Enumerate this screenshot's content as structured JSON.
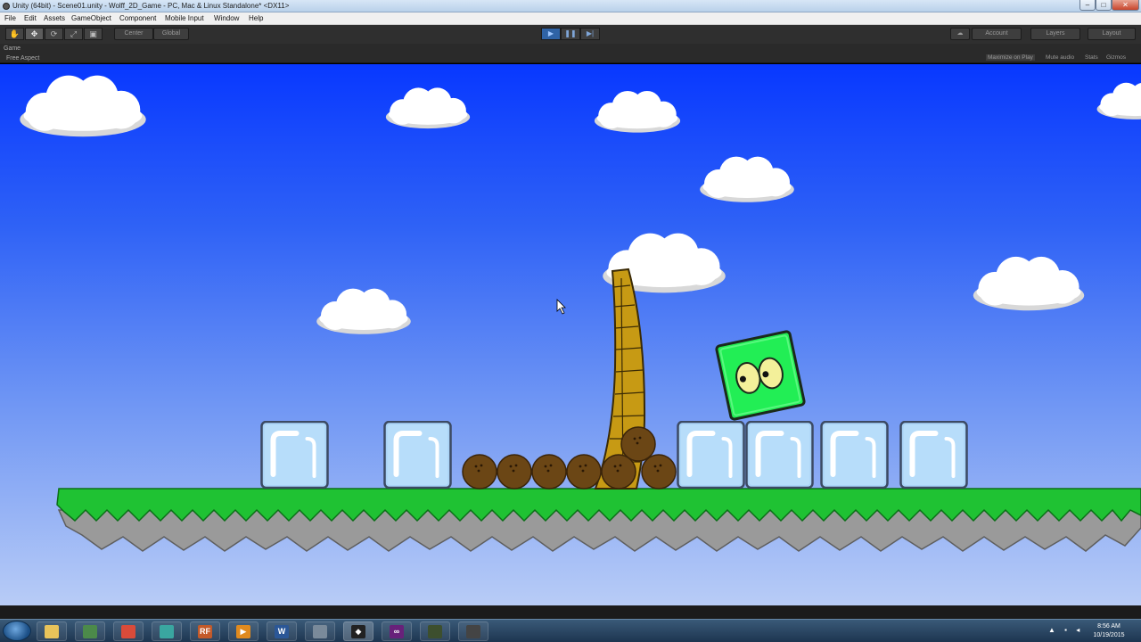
{
  "window": {
    "title": "Unity (64bit) - Scene01.unity - Wolff_2D_Game - PC, Mac & Linux Standalone* <DX11>",
    "min": "–",
    "max": "□",
    "close": "✕"
  },
  "menu": [
    "File",
    "Edit",
    "Assets",
    "GameObject",
    "Component",
    "Mobile Input",
    "Window",
    "Help"
  ],
  "toolbar": {
    "tools": [
      "✋",
      "✥",
      "⟳",
      "⤢",
      "▣"
    ],
    "pivot": "Center",
    "space": "Global",
    "play": "▶",
    "pause": "❚❚",
    "step": "▶|",
    "cloud": "☁",
    "account": "Account",
    "layers": "Layers",
    "layout": "Layout"
  },
  "game_view": {
    "tab": "Game",
    "aspect": "Free Aspect",
    "maximize_on_play": "Maximize on Play",
    "mute_audio": "Mute audio",
    "stats": "Stats",
    "gizmos": "Gizmos"
  },
  "taskbar": {
    "apps": [
      {
        "name": "explorer",
        "label": "",
        "color": "#e8c35a"
      },
      {
        "name": "monitor",
        "label": "",
        "color": "#4c8a4a"
      },
      {
        "name": "chrome",
        "label": "",
        "color": "#d94b3a"
      },
      {
        "name": "maya",
        "label": "",
        "color": "#3aa6a0"
      },
      {
        "name": "rf",
        "label": "RF",
        "color": "#c35a2a"
      },
      {
        "name": "media",
        "label": "▶",
        "color": "#e08a1e"
      },
      {
        "name": "word",
        "label": "W",
        "color": "#2b5797"
      },
      {
        "name": "tool",
        "label": "",
        "color": "#7a8a9a"
      },
      {
        "name": "unity",
        "label": "◆",
        "color": "#222"
      },
      {
        "name": "visual-studio",
        "label": "∞",
        "color": "#68217a"
      },
      {
        "name": "app-a",
        "label": "",
        "color": "#3d4f2e"
      },
      {
        "name": "app-b",
        "label": "",
        "color": "#444"
      }
    ],
    "time": "8:56 AM",
    "date": "10/19/2015"
  }
}
